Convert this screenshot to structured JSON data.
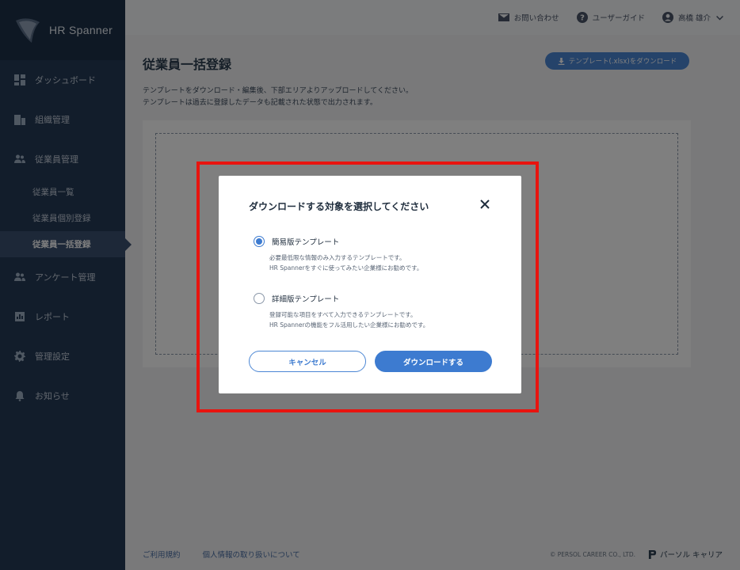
{
  "app": {
    "name": "HR Spanner"
  },
  "sidebar": {
    "items": [
      {
        "label": "ダッシュボード",
        "icon": "dashboard-icon"
      },
      {
        "label": "組織管理",
        "icon": "organization-icon"
      },
      {
        "label": "従業員管理",
        "icon": "people-icon"
      },
      {
        "label": "アンケート管理",
        "icon": "people-icon"
      },
      {
        "label": "レポート",
        "icon": "report-icon"
      },
      {
        "label": "管理設定",
        "icon": "gear-icon"
      },
      {
        "label": "お知らせ",
        "icon": "bell-icon"
      }
    ],
    "sub_items": [
      {
        "label": "従業員一覧"
      },
      {
        "label": "従業員個別登録"
      },
      {
        "label": "従業員一括登録",
        "active": true
      }
    ]
  },
  "header": {
    "contact": "お問い合わせ",
    "guide": "ユーザーガイド",
    "user_name": "高橋 雄介"
  },
  "main": {
    "title": "従業員一括登録",
    "template_button": "テンプレート(.xlsx)をダウンロード",
    "desc_line1": "テンプレートをダウンロード・編集後、下部エリアよりアップロードしてください。",
    "desc_line2": "テンプレートは過去に登録したデータも記載された状態で出力されます。"
  },
  "footer": {
    "terms": "ご利用規約",
    "privacy": "個人情報の取り扱いについて",
    "copyright": "© PERSOL CAREER CO., LTD.",
    "brand": "パーソル キャリア"
  },
  "modal": {
    "title": "ダウンロードする対象を選択してください",
    "options": [
      {
        "label": "簡易版テンプレート",
        "checked": true,
        "desc1": "必要最低限な情報のみ入力するテンプレートです。",
        "desc2": "HR Spannerをすぐに使ってみたい企業様にお勧めです。"
      },
      {
        "label": "詳細版テンプレート",
        "checked": false,
        "desc1": "登録可能な項目をすべて入力できるテンプレートです。",
        "desc2": "HR Spannerの機能をフル活用したい企業様にお勧めです。"
      }
    ],
    "cancel_label": "キャンセル",
    "download_label": "ダウンロードする"
  },
  "colors": {
    "sidebar_bg": "#253a57",
    "accent": "#3d7bd0",
    "highlight": "#e8140f"
  }
}
